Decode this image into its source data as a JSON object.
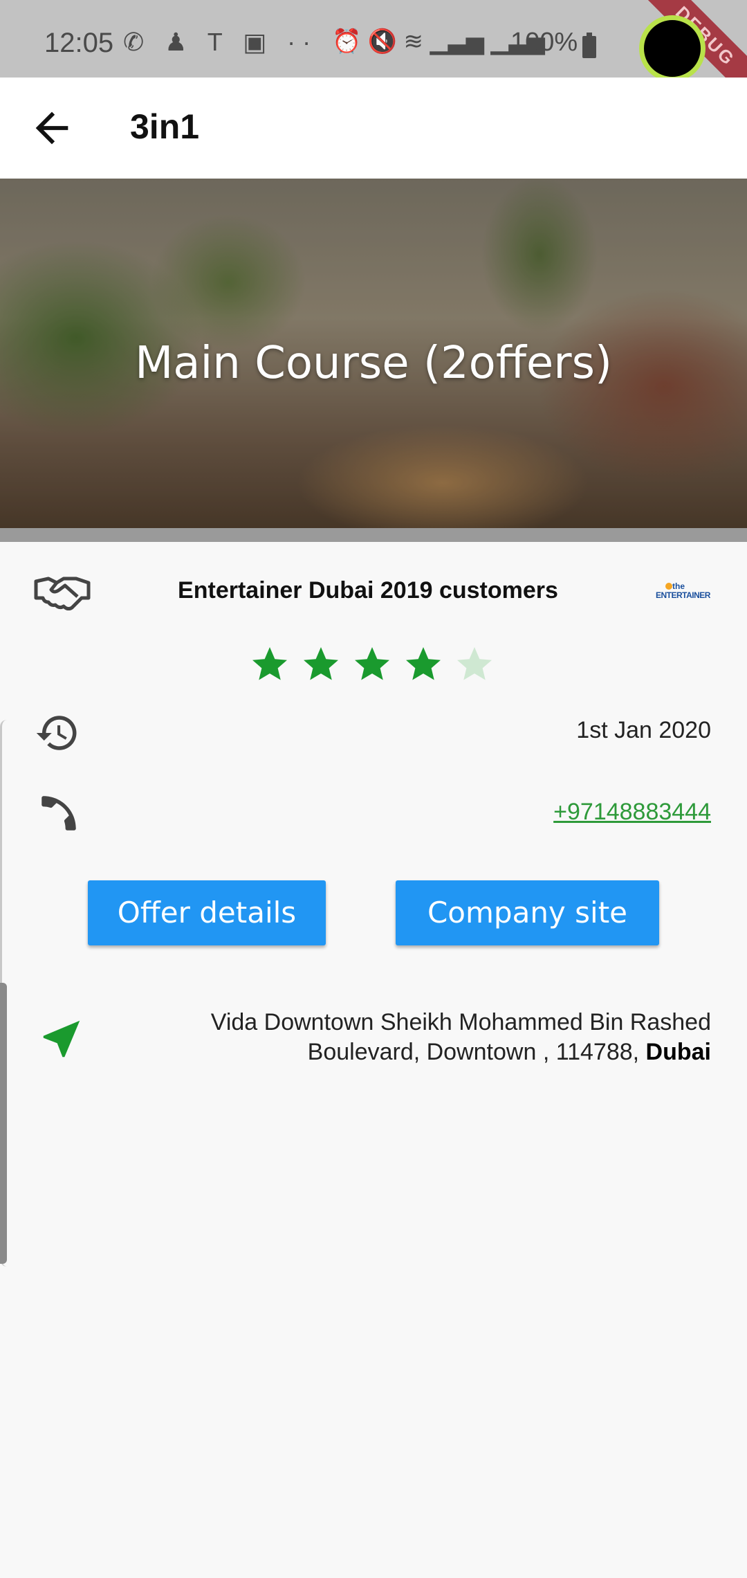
{
  "status_bar": {
    "time": "12:05",
    "battery": "100%",
    "debug_label": "DEBUG"
  },
  "app_bar": {
    "title": "3in1",
    "back_icon": "arrow-left-icon"
  },
  "hero": {
    "title": "Main Course (2offers)"
  },
  "partner": {
    "icon": "handshake-icon",
    "label": "Entertainer Dubai 2019 customers",
    "logo_small": "the",
    "logo_main": "ENTERTAINER"
  },
  "rating": {
    "value": 4,
    "max": 5,
    "color_on": "#1a9a2e",
    "color_off": "#cfe8d2"
  },
  "date": {
    "icon": "history-icon",
    "value": "1st Jan 2020"
  },
  "phone": {
    "icon": "phone-icon",
    "number": "+97148883444"
  },
  "buttons": {
    "offer_details": "Offer details",
    "company_site": "Company site"
  },
  "address": {
    "icon": "navigation-icon",
    "street": "Vida Downtown Sheikh Mohammed Bin Rashed Boulevard, Downtown , 114788, ",
    "city": "Dubai"
  },
  "colors": {
    "accent": "#2196f3",
    "link": "#2e9a3a",
    "nav_icon": "#1a9a2e"
  }
}
